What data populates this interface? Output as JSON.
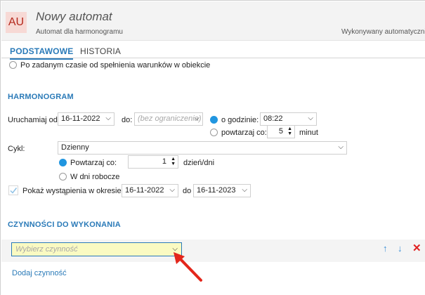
{
  "header": {
    "avatar": "AU",
    "title": "Nowy automat",
    "subtitle": "Automat dla harmonogramu",
    "execution_note": "Wykonywany automatycznie"
  },
  "tabs": [
    {
      "label": "PODSTAWOWE",
      "active": true
    },
    {
      "label": "HISTORIA",
      "active": false
    }
  ],
  "trigger": {
    "option_label": "Po zadanym czasie od spełnienia warunków w obiekcie"
  },
  "harmonogram": {
    "section_title": "HARMONOGRAM",
    "run_from_label": "Uruchamiaj od:",
    "run_from_value": "16-11-2022",
    "to_label": "do:",
    "to_placeholder": "(bez ograniczenia)",
    "at_time_label": "o godzinie:",
    "at_time_value": "08:22",
    "repeat_every_label": "powtarzaj co:",
    "repeat_every_value": "5",
    "repeat_every_unit": "minut",
    "cycle_label": "Cykl:",
    "cycle_value": "Dzienny",
    "repeat_days_label": "Powtarzaj co:",
    "repeat_days_value": "1",
    "repeat_days_unit": "dzień/dni",
    "workdays_label": "W dni robocze",
    "show_occurrences_label": "Pokaż wystąpienia w okresie od",
    "occ_from": "16-11-2022",
    "occ_to_label": "do",
    "occ_to": "16-11-2023"
  },
  "actions": {
    "section_title": "CZYNNOŚCI DO WYKONANIA",
    "select_placeholder": "Wybierz czynność",
    "add_link": "Dodaj czynność"
  },
  "colors": {
    "accent": "#2a7ab8",
    "radio_checked": "#2196e0",
    "delete": "#e02020",
    "highlight_input": "#fafac2",
    "annotation_arrow": "#e3261b"
  }
}
